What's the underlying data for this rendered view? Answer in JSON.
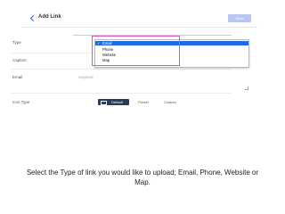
{
  "header": {
    "title": "Add Link",
    "save_label": "Save"
  },
  "fields": {
    "type_label": "Type",
    "caption_label": "Caption",
    "email_label": "Email",
    "email_placeholder": "required",
    "icon_type_label": "Icon Type"
  },
  "icon_type": {
    "options": [
      "Default",
      "Preset",
      "Custom"
    ],
    "selected": "Default"
  },
  "type_dropdown": {
    "check": "✓",
    "options": [
      "Email",
      "Phone",
      "Website",
      "Map"
    ],
    "selected": "Email"
  },
  "instruction": "Select the Type of link you would like to upload; Email, Phone, Website or Map.",
  "colors": {
    "accent": "#1f6ae0",
    "highlight": "#e052c8",
    "save_button": "#b9c6f4",
    "segment_active": "#2b3a57"
  },
  "icons": {
    "back": "chevron-left-icon",
    "resize": "resize-handle-icon",
    "segment": "image-icon"
  }
}
